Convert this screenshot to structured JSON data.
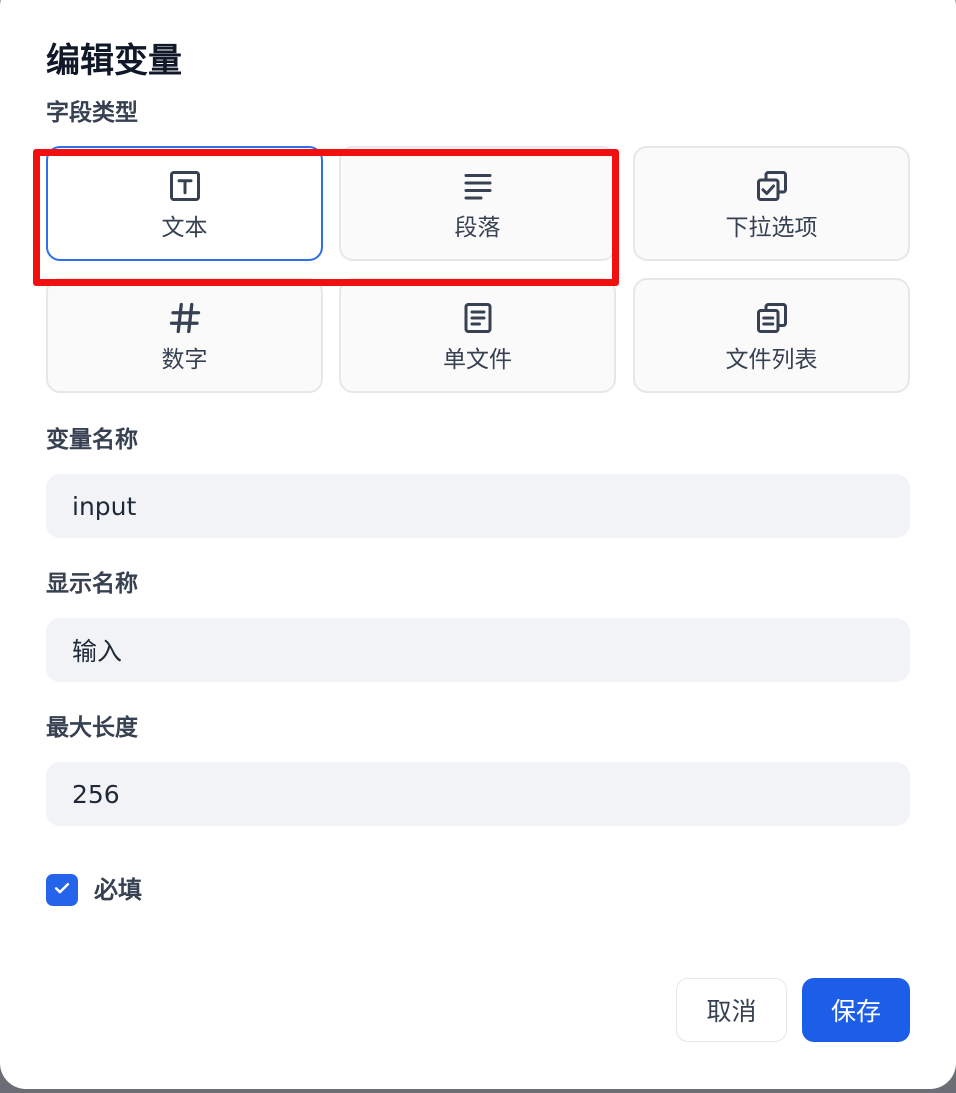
{
  "dialog": {
    "title": "编辑变量",
    "field_type_label": "字段类型",
    "field_types": [
      {
        "label": "文本",
        "icon": "text-icon",
        "selected": true
      },
      {
        "label": "段落",
        "icon": "paragraph-icon",
        "selected": false
      },
      {
        "label": "下拉选项",
        "icon": "select-icon",
        "selected": false
      },
      {
        "label": "数字",
        "icon": "hash-icon",
        "selected": false
      },
      {
        "label": "单文件",
        "icon": "file-icon",
        "selected": false
      },
      {
        "label": "文件列表",
        "icon": "file-list-icon",
        "selected": false
      }
    ],
    "variable_name": {
      "label": "变量名称",
      "value": "input"
    },
    "display_name": {
      "label": "显示名称",
      "value": "输入"
    },
    "max_length": {
      "label": "最大长度",
      "value": "256"
    },
    "required": {
      "label": "必填",
      "checked": true
    },
    "buttons": {
      "cancel": "取消",
      "save": "保存"
    }
  },
  "colors": {
    "accent": "#1d5ee8",
    "selected_border": "#2f6fea",
    "highlight": "#f10f0f"
  }
}
